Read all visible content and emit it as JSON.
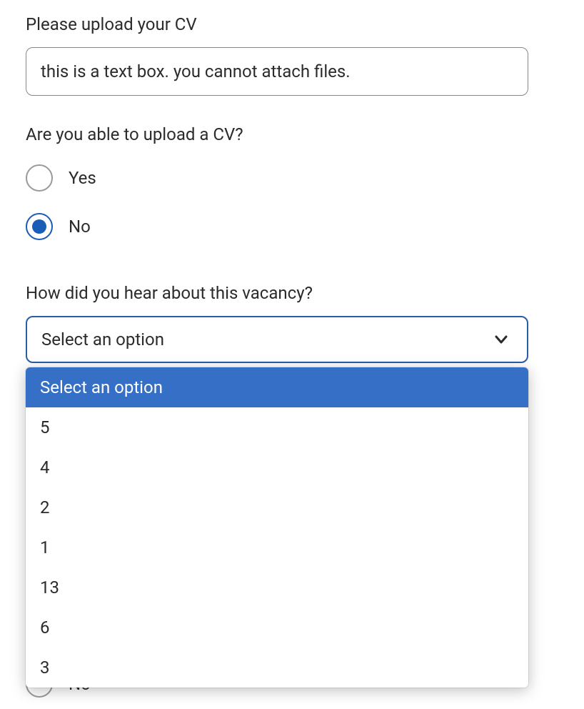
{
  "cv_upload": {
    "label": "Please upload your CV",
    "value": "this is a text box. you cannot attach files."
  },
  "able_upload": {
    "label": "Are you able to upload a CV?",
    "options": [
      "Yes",
      "No"
    ],
    "selected": "No"
  },
  "vacancy_source": {
    "label": "How did you hear about this vacancy?",
    "placeholder": "Select an option",
    "dropdown_options": [
      "Select an option",
      "5",
      "4",
      "2",
      "1",
      "13",
      "6",
      "3"
    ],
    "highlighted_index": 0
  },
  "hidden_radio": {
    "label": "No"
  }
}
